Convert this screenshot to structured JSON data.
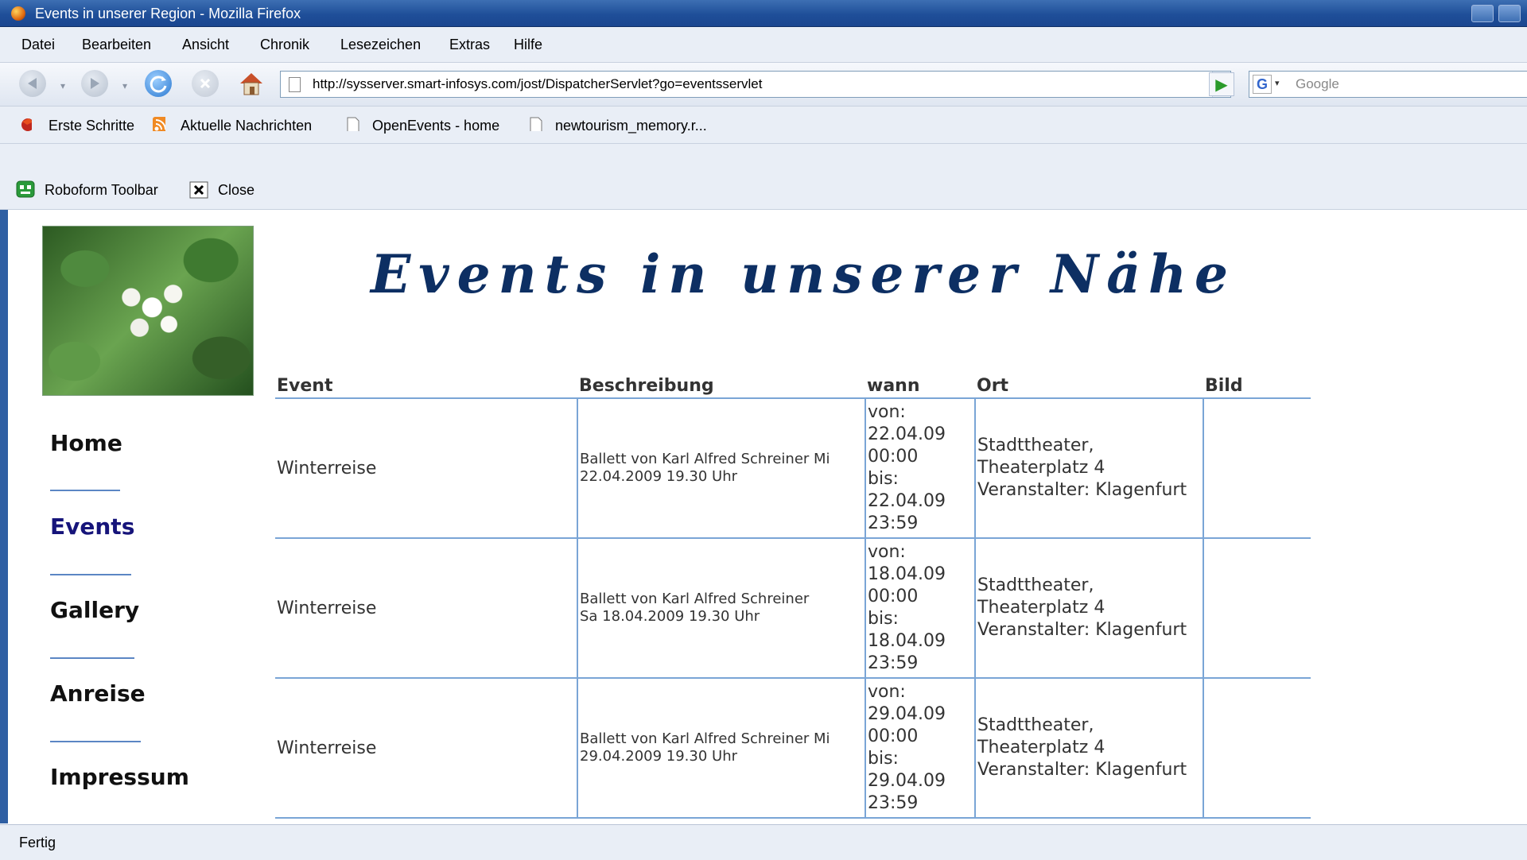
{
  "window": {
    "title": "Events in unserer Region - Mozilla Firefox"
  },
  "menu": [
    "Datei",
    "Bearbeiten",
    "Ansicht",
    "Chronik",
    "Lesezeichen",
    "Extras",
    "Hilfe"
  ],
  "navbar": {
    "url": "http://sysserver.smart-infosys.com/jost/DispatcherServlet?go=eventsservlet",
    "search_placeholder": "Google"
  },
  "bookmarks": [
    "Erste Schritte",
    "Aktuelle Nachrichten",
    "OpenEvents - home",
    "newtourism_memory.r..."
  ],
  "roboform": {
    "label": "Roboform Toolbar",
    "close": "Close"
  },
  "page": {
    "heading": "Events in unserer Nähe",
    "nav": [
      "Home",
      "Events",
      "Gallery",
      "Anreise",
      "Impressum"
    ],
    "table": {
      "headers": [
        "Event",
        "Beschreibung",
        "wann",
        "Ort",
        "Bild"
      ],
      "rows": [
        {
          "event": "Winterreise",
          "desc1": "Ballett von Karl Alfred Schreiner Mi",
          "desc2": "22.04.2009 19.30 Uhr",
          "w1": "von:",
          "w2": "22.04.09",
          "w3": "00:00",
          "w4": "bis:",
          "w5": "22.04.09",
          "w6": "23:59",
          "o1": "Stadttheater,",
          "o2": "Theaterplatz 4",
          "o3": "Veranstalter: Klagenfurt"
        },
        {
          "event": "Winterreise",
          "desc1": "Ballett von Karl Alfred Schreiner",
          "desc2": "Sa 18.04.2009 19.30 Uhr",
          "w1": "von:",
          "w2": "18.04.09",
          "w3": "00:00",
          "w4": "bis:",
          "w5": "18.04.09",
          "w6": "23:59",
          "o1": "Stadttheater,",
          "o2": "Theaterplatz 4",
          "o3": "Veranstalter: Klagenfurt"
        },
        {
          "event": "Winterreise",
          "desc1": "Ballett von Karl Alfred Schreiner Mi",
          "desc2": "29.04.2009 19.30 Uhr",
          "w1": "von:",
          "w2": "29.04.09",
          "w3": "00:00",
          "w4": "bis:",
          "w5": "29.04.09",
          "w6": "23:59",
          "o1": "Stadttheater,",
          "o2": "Theaterplatz 4",
          "o3": "Veranstalter: Klagenfurt"
        }
      ]
    }
  },
  "status": "Fertig"
}
